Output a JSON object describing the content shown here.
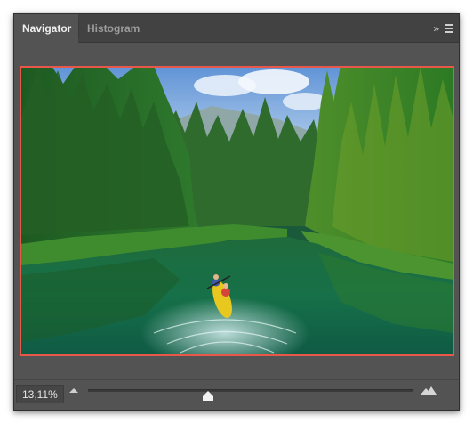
{
  "panel": {
    "tabs": [
      {
        "label": "Navigator",
        "active": true
      },
      {
        "label": "Histogram",
        "active": false
      }
    ],
    "collapse_icon": "»",
    "menu_icon": "hamburger-menu-icon"
  },
  "preview": {
    "subject": "river-kayak-forest-landscape",
    "proxy_color": "#e9564a"
  },
  "zoom": {
    "value_text": "13,11%",
    "slider_fraction": 0.37,
    "zoom_out_icon": "small-mountain-icon",
    "zoom_in_icon": "large-mountain-icon"
  }
}
